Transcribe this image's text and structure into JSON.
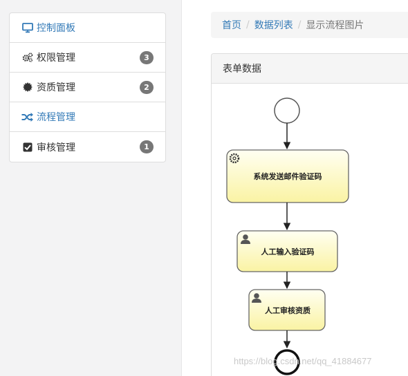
{
  "sidebar": {
    "items": [
      {
        "label": "控制面板",
        "icon": "monitor-icon",
        "badge": ""
      },
      {
        "label": "权限管理",
        "icon": "gears-icon",
        "badge": "3"
      },
      {
        "label": "资质管理",
        "icon": "certificate-icon",
        "badge": "2"
      },
      {
        "label": "流程管理",
        "icon": "random-icon",
        "badge": ""
      },
      {
        "label": "审核管理",
        "icon": "checkbox-icon",
        "badge": "1"
      }
    ]
  },
  "breadcrumb": {
    "home": "首页",
    "list": "数据列表",
    "current": "显示流程图片",
    "separator": "/"
  },
  "panel": {
    "title": "表单数据"
  },
  "diagram": {
    "tasks": [
      {
        "label": "系统发送邮件验证码",
        "type": "service-task"
      },
      {
        "label": "人工输入验证码",
        "type": "user-task"
      },
      {
        "label": "人工审核资质",
        "type": "user-task"
      }
    ]
  },
  "watermark": "https://blog.csdn.net/qq_41884677",
  "colors": {
    "link": "#337ab7",
    "badge": "#777777",
    "task_fill_top": "#fffff0",
    "task_fill_bottom": "#fbf5a8"
  }
}
